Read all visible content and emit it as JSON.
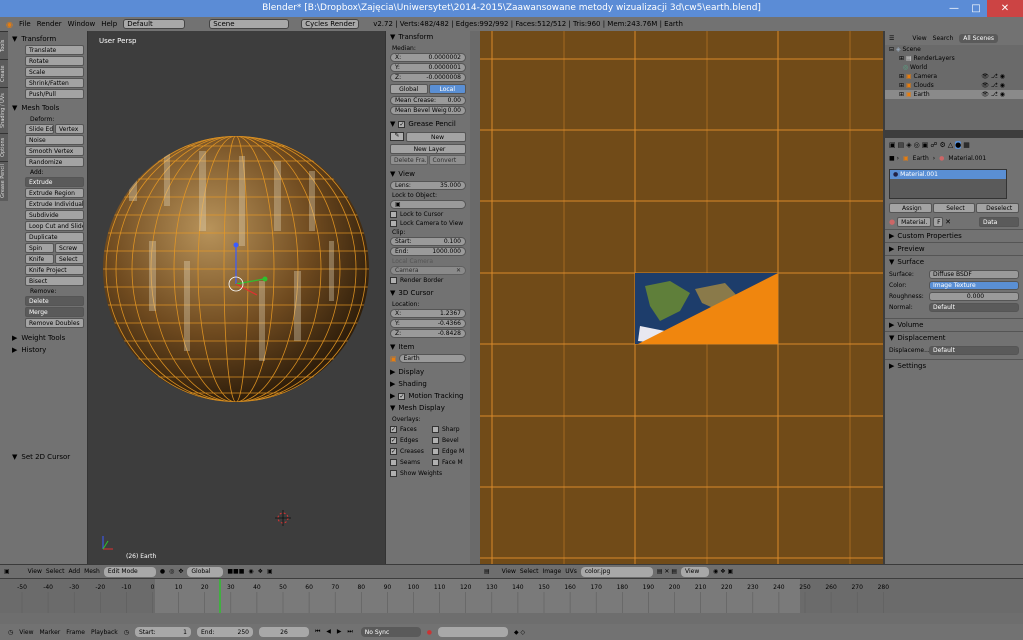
{
  "title": "Blender* [B:\\Dropbox\\Zajęcia\\Uniwersytet\\2014-2015\\Zaawansowane metody wizualizacji 3d\\cw5\\earth.blend]",
  "menu": {
    "file": "File",
    "render": "Render",
    "window": "Window",
    "help": "Help",
    "layout": "Default",
    "scene": "Scene",
    "engine": "Cycles Render",
    "stats": "v2.72 | Verts:482/482 | Edges:992/992 | Faces:512/512 | Tris:960 | Mem:243.76M | Earth"
  },
  "tool_tabs": [
    "Tools",
    "Create",
    "Shading / UVs",
    "Options",
    "Grease Pencil"
  ],
  "tools": {
    "transform": "Transform",
    "translate": "Translate",
    "rotate": "Rotate",
    "scale": "Scale",
    "shrink": "Shrink/Fatten",
    "push": "Push/Pull",
    "mesh_tools": "Mesh Tools",
    "deform": "Deform:",
    "slide_edge": "Slide Edg",
    "vertex": "Vertex",
    "noise": "Noise",
    "smooth": "Smooth Vertex",
    "randomize": "Randomize",
    "add": "Add:",
    "extrude": "Extrude",
    "extrude_region": "Extrude Region",
    "extrude_indiv": "Extrude Individual",
    "subdivide": "Subdivide",
    "loop_cut": "Loop Cut and Slide",
    "duplicate": "Duplicate",
    "spin": "Spin",
    "screw": "Screw",
    "knife": "Knife",
    "select": "Select",
    "knife_project": "Knife Project",
    "bisect": "Bisect",
    "remove": "Remove:",
    "delete": "Delete",
    "merge": "Merge",
    "remove_doubles": "Remove Doubles",
    "weight_tools": "Weight Tools",
    "history": "History",
    "set_cursor": "Set 2D Cursor"
  },
  "viewport": {
    "label": "User Persp",
    "object_label": "(26) Earth"
  },
  "props_n": {
    "transform": "Transform",
    "median": "Median:",
    "x_label": "X:",
    "x": "0.0000002",
    "y_label": "Y:",
    "y": "0.0000001",
    "z_label": "Z:",
    "z": "-0.0000008",
    "global": "Global",
    "local": "Local",
    "mean_crease": "Mean Crease:",
    "mean_crease_val": "0.00",
    "mean_bevel": "Mean Bevel Weig",
    "mean_bevel_val": "0.00",
    "grease": "Grease Pencil",
    "new": "New",
    "new_layer": "New Layer",
    "delete_fra": "Delete Fra...",
    "convert": "Convert",
    "view": "View",
    "lens": "Lens:",
    "lens_val": "35.000",
    "lock_object": "Lock to Object:",
    "lock_cursor": "Lock to Cursor",
    "lock_camera": "Lock Camera to View",
    "clip": "Clip:",
    "clip_start": "Start:",
    "clip_start_val": "0.100",
    "clip_end": "End:",
    "clip_end_val": "1000.000",
    "local_camera": "Local Camera",
    "camera": "Camera",
    "render_border": "Render Border",
    "cursor3d": "3D Cursor",
    "location": "Location:",
    "cx": "1.2367",
    "cy": "-0.4366",
    "cz": "-0.8428",
    "item": "Item",
    "item_name": "Earth",
    "display": "Display",
    "shading": "Shading",
    "motion": "Motion Tracking",
    "mesh_display": "Mesh Display",
    "overlays": "Overlays:",
    "faces": "Faces",
    "sharp": "Sharp",
    "edges": "Edges",
    "bevel": "Bevel",
    "creases": "Creases",
    "edge_m": "Edge M",
    "seams": "Seams",
    "face_m": "Face M",
    "show_weights": "Show Weights"
  },
  "vp_header": {
    "view": "View",
    "select": "Select",
    "add": "Add",
    "mesh": "Mesh",
    "mode": "Edit Mode",
    "orientation": "Global"
  },
  "uv_header": {
    "view": "View",
    "select": "Select",
    "image": "Image",
    "uvs": "UVs",
    "image_name": "color.jpg",
    "view2": "View"
  },
  "outliner": {
    "view": "View",
    "search": "Search",
    "all_scenes": "All Scenes",
    "items": [
      "Scene",
      "RenderLayers",
      "World",
      "Camera",
      "Clouds",
      "Earth"
    ]
  },
  "properties": {
    "earth": "Earth",
    "material_path": "Material.001",
    "slot": "Material.001",
    "assign": "Assign",
    "select": "Select",
    "deselect": "Deselect",
    "mat_field": "Material.",
    "mat_f": "F",
    "data": "Data",
    "custom_props": "Custom Properties",
    "preview": "Preview",
    "surface": "Surface",
    "surface_label": "Surface:",
    "surface_val": "Diffuse BSDF",
    "color_label": "Color:",
    "color_val": "Image Texture",
    "rough_label": "Roughness:",
    "rough_val": "0.000",
    "normal_label": "Normal:",
    "normal_val": "Default",
    "volume": "Volume",
    "displacement": "Displacement",
    "displace_label": "Displaceme...",
    "displace_val": "Default",
    "settings": "Settings"
  },
  "timeline": {
    "ticks": [
      "-50",
      "-40",
      "-30",
      "-20",
      "-10",
      "0",
      "10",
      "20",
      "30",
      "40",
      "50",
      "60",
      "70",
      "80",
      "90",
      "100",
      "110",
      "120",
      "130",
      "140",
      "150",
      "160",
      "170",
      "180",
      "190",
      "200",
      "210",
      "220",
      "230",
      "240",
      "250",
      "260",
      "270",
      "280"
    ],
    "view": "View",
    "marker": "Marker",
    "frame": "Frame",
    "playback": "Playback",
    "start_label": "Start:",
    "start": "1",
    "end_label": "End:",
    "end": "250",
    "current": "26",
    "sync": "No Sync"
  }
}
